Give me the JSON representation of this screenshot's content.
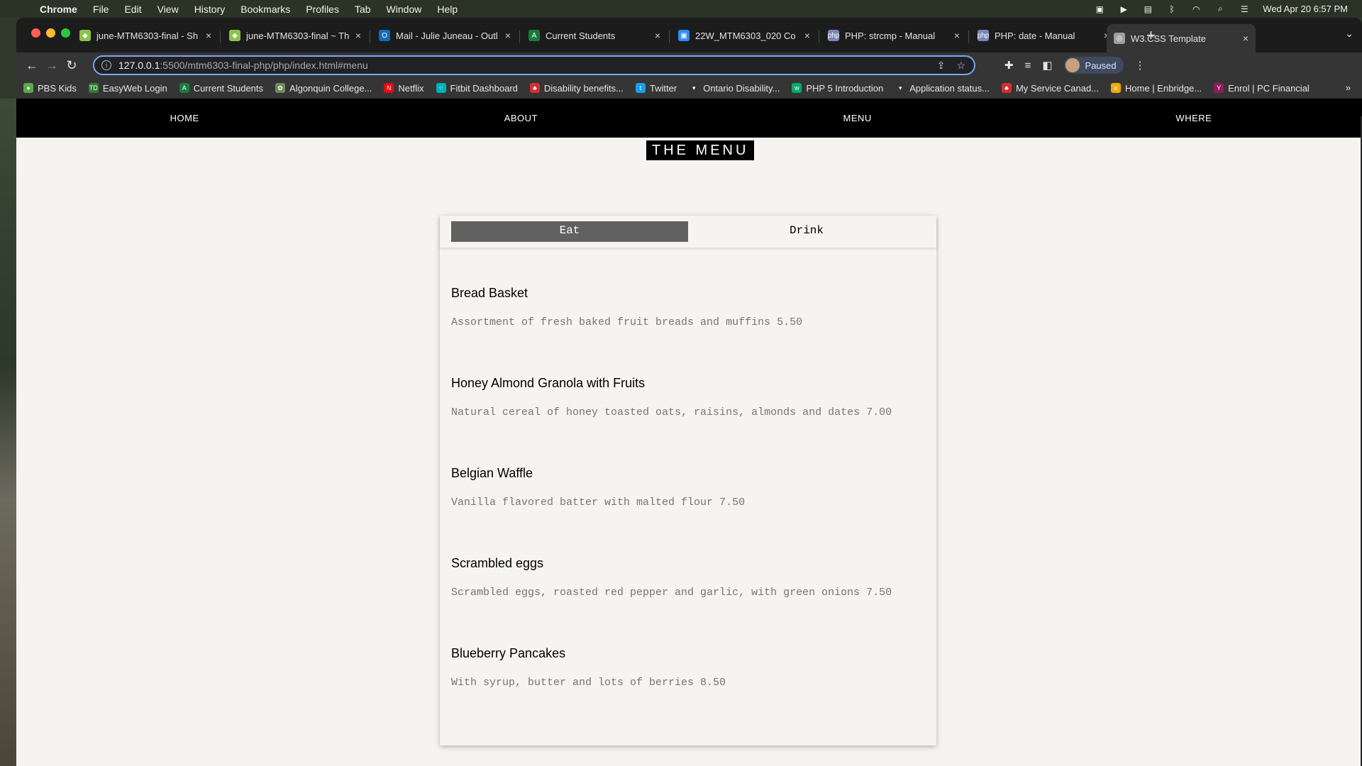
{
  "os_menubar": {
    "app": "Chrome",
    "items": [
      "File",
      "Edit",
      "View",
      "History",
      "Bookmarks",
      "Profiles",
      "Tab",
      "Window",
      "Help"
    ],
    "clock": "Wed Apr 20  6:57 PM"
  },
  "browser": {
    "tabs": [
      {
        "label": "june-MTM6303-final - Sh",
        "color": "#8bc34a",
        "glyph": "◆"
      },
      {
        "label": "june-MTM6303-final ~ Th",
        "color": "#8bc34a",
        "glyph": "◆"
      },
      {
        "label": "Mail - Julie Juneau - Outl",
        "color": "#0f6cbd",
        "glyph": "O"
      },
      {
        "label": "Current Students",
        "color": "#1b7a3e",
        "glyph": "A"
      },
      {
        "label": "22W_MTM6303_020 Co",
        "color": "#2d8cff",
        "glyph": "▣"
      },
      {
        "label": "PHP: strcmp - Manual",
        "color": "#7a86b8",
        "glyph": "php"
      },
      {
        "label": "PHP: date - Manual",
        "color": "#7a86b8",
        "glyph": "php"
      },
      {
        "label": "W3.CSS Template",
        "color": "#9e9e9e",
        "glyph": "◎"
      }
    ],
    "url_host": "127.0.0.1",
    "url_path": ":5500/mtm6303-final-php/php/index.html#menu",
    "profile_status": "Paused",
    "bookmarks": [
      {
        "label": "PBS Kids",
        "color": "#58a94b",
        "glyph": "●"
      },
      {
        "label": "EasyWeb Login",
        "color": "#2e7d32",
        "glyph": "TD"
      },
      {
        "label": "Current Students",
        "color": "#1b7a3e",
        "glyph": "A"
      },
      {
        "label": "Algonquin College...",
        "color": "#6d8b5a",
        "glyph": "✿"
      },
      {
        "label": "Netflix",
        "color": "#e50914",
        "glyph": "N"
      },
      {
        "label": "Fitbit Dashboard",
        "color": "#00b0b9",
        "glyph": "⁘"
      },
      {
        "label": "Disability benefits...",
        "color": "#d32f2f",
        "glyph": "♣"
      },
      {
        "label": "Twitter",
        "color": "#1d9bf0",
        "glyph": "t"
      },
      {
        "label": "Ontario Disability...",
        "color": "#333333",
        "glyph": "▾"
      },
      {
        "label": "PHP 5 Introduction",
        "color": "#04aa6d",
        "glyph": "w"
      },
      {
        "label": "Application status...",
        "color": "#333333",
        "glyph": "▾"
      },
      {
        "label": "My Service Canad...",
        "color": "#d32f2f",
        "glyph": "♣"
      },
      {
        "label": "Home | Enbridge...",
        "color": "#f2a900",
        "glyph": "e"
      },
      {
        "label": "Enrol | PC Financial",
        "color": "#8e1b5c",
        "glyph": "Y"
      }
    ]
  },
  "site": {
    "nav": [
      "HOME",
      "ABOUT",
      "MENU",
      "WHERE"
    ],
    "section_title": "THE MENU",
    "tabs": [
      "Eat",
      "Drink"
    ],
    "items": [
      {
        "name": "Bread Basket",
        "desc": "Assortment of fresh baked fruit breads and muffins 5.50"
      },
      {
        "name": "Honey Almond Granola with Fruits",
        "desc": "Natural cereal of honey toasted oats, raisins, almonds and dates 7.00"
      },
      {
        "name": "Belgian Waffle",
        "desc": "Vanilla flavored batter with malted flour 7.50"
      },
      {
        "name": "Scrambled eggs",
        "desc": "Scrambled eggs, roasted red pepper and garlic, with green onions 7.50"
      },
      {
        "name": "Blueberry Pancakes",
        "desc": "With syrup, butter and lots of berries 8.50"
      }
    ]
  }
}
